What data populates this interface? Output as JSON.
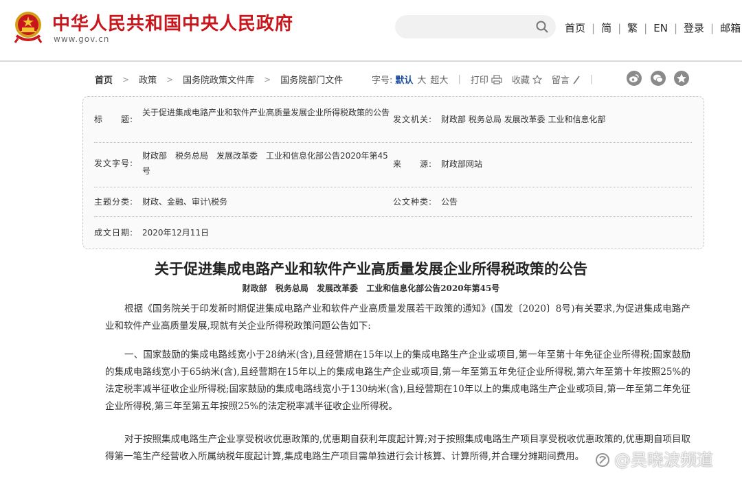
{
  "header": {
    "site_title": "中华人民共和国中央人民政府",
    "site_domain": "www.gov.cn",
    "search": {
      "placeholder": ""
    },
    "links": [
      "首页",
      "简",
      "繁",
      "EN",
      "登录",
      "邮箱"
    ]
  },
  "breadcrumb": [
    "首页",
    "政策",
    "国务院政策文件库",
    "国务院部门文件"
  ],
  "tools": {
    "font_label": "字号:",
    "font_default": "默认",
    "font_large": "大",
    "font_xlarge": "超大",
    "print": "打印",
    "favorite": "收藏",
    "comment": "留言"
  },
  "share_icons": [
    "weibo-icon",
    "wechat-icon",
    "star-icon"
  ],
  "meta": {
    "title_label": "标　　题:",
    "title_value": "关于促进集成电路产业和软件产业高质量发展企业所得税政策的公告",
    "issuer_label": "发文机关:",
    "issuer_value": "财政部  税务总局  发展改革委  工业和信息化部",
    "doc_no_label": "发文字号:",
    "doc_no_value": "财政部　税务总局　发展改革委　工业和信息化部公告2020年第45号",
    "source_label": "来　　源:",
    "source_value": "财政部网站",
    "category_label": "主题分类:",
    "category_value": "财政、金融、审计\\税务",
    "doc_type_label": "公文种类:",
    "doc_type_value": "公告",
    "date_label": "成文日期:",
    "date_value": "2020年12月11日"
  },
  "article": {
    "title": "关于促进集成电路产业和软件产业高质量发展企业所得税政策的公告",
    "subtitle": "财政部 税务总局 发展改革委 工业和信息化部公告2020年第45号",
    "paragraphs": [
      "根据《国务院关于印发新时期促进集成电路产业和软件产业高质量发展若干政策的通知》(国发〔2020〕8号)有关要求,为促进集成电路产业和软件产业高质量发展,现就有关企业所得税政策问题公告如下:",
      "一、国家鼓励的集成电路线宽小于28纳米(含),且经营期在15年以上的集成电路生产企业或项目,第一年至第十年免征企业所得税;国家鼓励的集成电路线宽小于65纳米(含),且经营期在15年以上的集成电路生产企业或项目,第一年至第五年免征企业所得税,第六年至第十年按照25%的法定税率减半征收企业所得税;国家鼓励的集成电路线宽小于130纳米(含),且经营期在10年以上的集成电路生产企业或项目,第一年至第二年免征企业所得税,第三年至第五年按照25%的法定税率减半征收企业所得税。",
      "对于按照集成电路生产企业享受税收优惠政策的,优惠期自获利年度起计算;对于按照集成电路生产项目享受税收优惠政策的,优惠期自项目取得第一笔生产经营收入所属纳税年度起计算,集成电路生产项目需单独进行会计核算、计算所得,并合理分摊期间费用。"
    ]
  },
  "watermark": "@吴晓波频道",
  "colors": {
    "brand_red": "#c8161d",
    "link_blue": "#1d4e9e"
  }
}
